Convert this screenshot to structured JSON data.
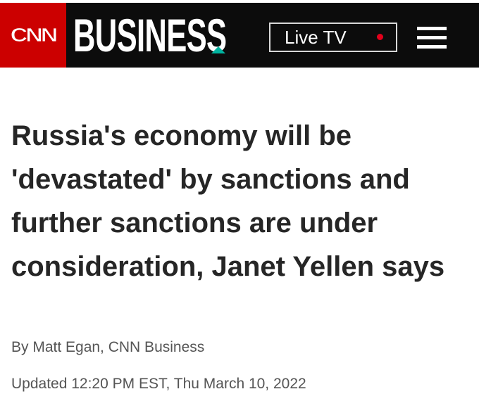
{
  "header": {
    "logo_text": "CNN",
    "brand": "BUSINESS",
    "live_tv_label": "Live TV",
    "menu_icon": "hamburger-menu-icon",
    "colors": {
      "bar": "#0c0c0c",
      "logo_red": "#cc0000",
      "accent": "#00b4a0",
      "live_dot": "#e3001b"
    }
  },
  "article": {
    "headline": "Russia's economy will be 'devastated' by sanctions and further sanctions are under consideration, Janet Yellen says",
    "byline": "By Matt Egan, CNN Business",
    "updated": "Updated 12:20 PM EST, Thu March 10, 2022"
  }
}
